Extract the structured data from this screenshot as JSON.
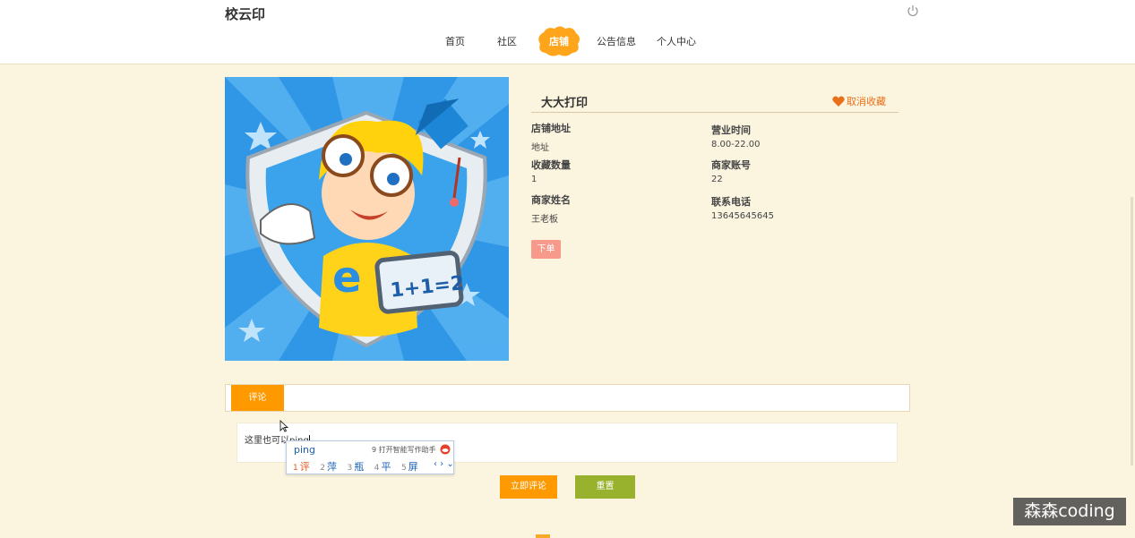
{
  "header": {
    "brand": "校云印",
    "nav": [
      "首页",
      "社区",
      "店铺",
      "公告信息",
      "个人中心"
    ],
    "active_nav": "店铺",
    "icons": {
      "power": "power-icon"
    }
  },
  "shop": {
    "image_icon": "shop-avatar-cartoon-boy",
    "name": "大大打印",
    "favorite_label": "取消收藏",
    "fields": {
      "address_label": "店铺地址",
      "address_value": "地址",
      "hours_label": "营业时间",
      "hours_value": "8.00-22.00",
      "favorites_label": "收藏数量",
      "favorites_value": "1",
      "account_label": "商家账号",
      "account_value": "22",
      "owner_label": "商家姓名",
      "owner_value": "王老板",
      "phone_label": "联系电话",
      "phone_value": "13645645645"
    },
    "order_button": "下单"
  },
  "comments": {
    "tab_label": "评论",
    "input_value": "这里也可以ping",
    "submit_button": "立即评论",
    "reset_button": "重置"
  },
  "ime": {
    "input": "ping",
    "tip": "9 打开智能写作助手",
    "candidates": [
      {
        "num": "1",
        "text": "评"
      },
      {
        "num": "2",
        "text": "萍"
      },
      {
        "num": "3",
        "text": "瓶"
      },
      {
        "num": "4",
        "text": "平"
      },
      {
        "num": "5",
        "text": "屏"
      }
    ],
    "nav_arrows": "‹ › ⌄"
  },
  "watermark": "森森coding",
  "colors": {
    "accent_orange": "#ff9900",
    "reset_green": "#99b22e",
    "order_pink": "#f79a8c",
    "page_bg": "#fbf4df",
    "favorite_orange": "#e9701a"
  }
}
